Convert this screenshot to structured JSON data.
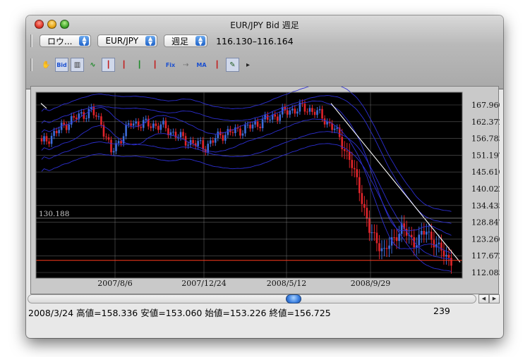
{
  "window": {
    "title": "EUR/JPY Bid 週足"
  },
  "toolbar": {
    "chart_type": "ロウ...",
    "symbol": "EUR/JPY",
    "period": "週足",
    "range": "116.130–116.164",
    "tools": [
      {
        "name": "hand-icon",
        "glyph": "✋"
      },
      {
        "name": "bid-ask-icon",
        "glyph": "Bid"
      },
      {
        "name": "volume-chart-icon",
        "glyph": "▥"
      },
      {
        "name": "oscillator-icon",
        "glyph": "∿"
      },
      {
        "name": "candlestick-icon",
        "glyph": "┃"
      },
      {
        "name": "candlestick-color-icon",
        "glyph": "┃"
      },
      {
        "name": "candlestick-mixed-icon",
        "glyph": "┃"
      },
      {
        "name": "bar-chart-icon",
        "glyph": "┃"
      },
      {
        "name": "fix-icon",
        "glyph": "Fix"
      },
      {
        "name": "arrow-icon",
        "glyph": "⇢"
      },
      {
        "name": "ma-fix-icon",
        "glyph": "MA"
      },
      {
        "name": "bars-overlay-icon",
        "glyph": "┃"
      },
      {
        "name": "pencil-icon",
        "glyph": "✎"
      },
      {
        "name": "export-icon",
        "glyph": "▸"
      }
    ]
  },
  "chart_data": {
    "type": "candlestick",
    "price_axis": [
      "167.960",
      "162.372",
      "156.785",
      "151.197",
      "145.610",
      "140.022",
      "134.435",
      "128.847",
      "123.260",
      "117.672",
      "112.085"
    ],
    "date_axis": [
      "2007/8/6",
      "2007/12/24",
      "2008/5/12",
      "2008/9/29"
    ],
    "ylim": [
      112.085,
      167.96
    ],
    "marker_label": "130.188",
    "current_price_line": 116.13,
    "colors": {
      "up": "#3d6cd9",
      "down": "#e0242b",
      "band": "#2d2fd2",
      "trend": "#ffffff",
      "grid": "#a8a8a8",
      "price_line": "#ff3a1e"
    }
  },
  "status": {
    "text": "2008/3/24 高値=158.336 安値=153.060 始値=153.226 終値=156.725",
    "count": "239"
  }
}
